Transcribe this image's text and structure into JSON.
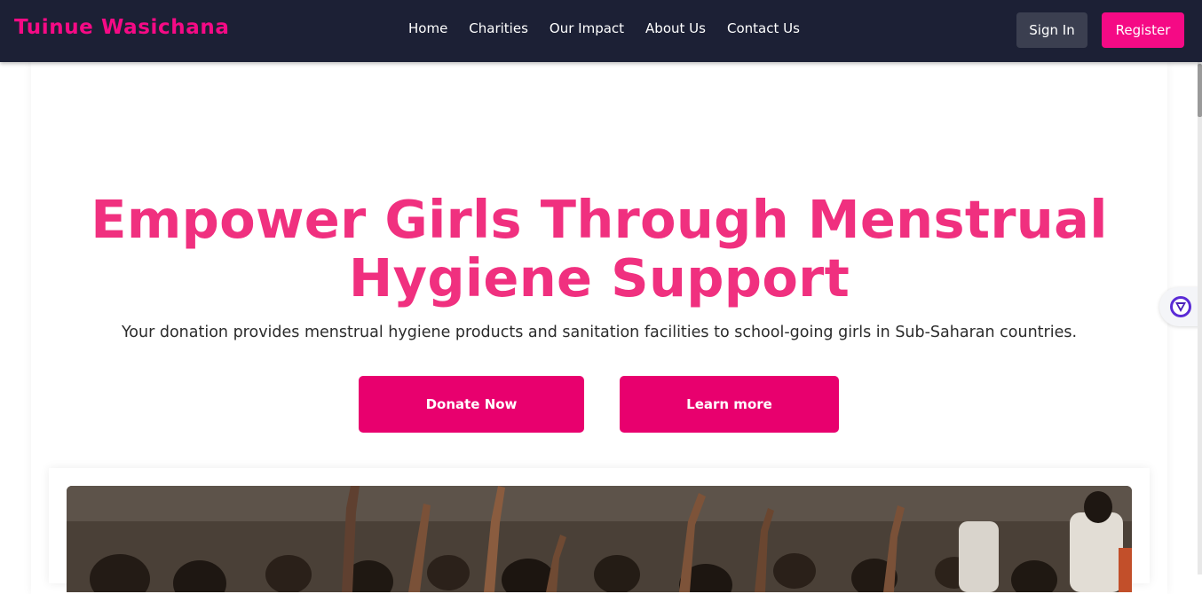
{
  "nav": {
    "brand": "Tuinue Wasichana",
    "links": [
      "Home",
      "Charities",
      "Our Impact",
      "About Us",
      "Contact Us"
    ],
    "sign_in": "Sign In",
    "register": "Register"
  },
  "hero": {
    "title": "Empower Girls Through Menstrual Hygiene Support",
    "subtitle": "Your donation provides menstrual hygiene products and sanitation facilities to school-going girls in Sub-Saharan countries.",
    "donate_label": "Donate Now",
    "learn_label": "Learn more"
  },
  "colors": {
    "accent": "#f50a85",
    "title": "#f0307f",
    "button": "#e8006e",
    "navbar": "#1c2035"
  },
  "icons": {
    "extension": "shield-v-icon"
  }
}
